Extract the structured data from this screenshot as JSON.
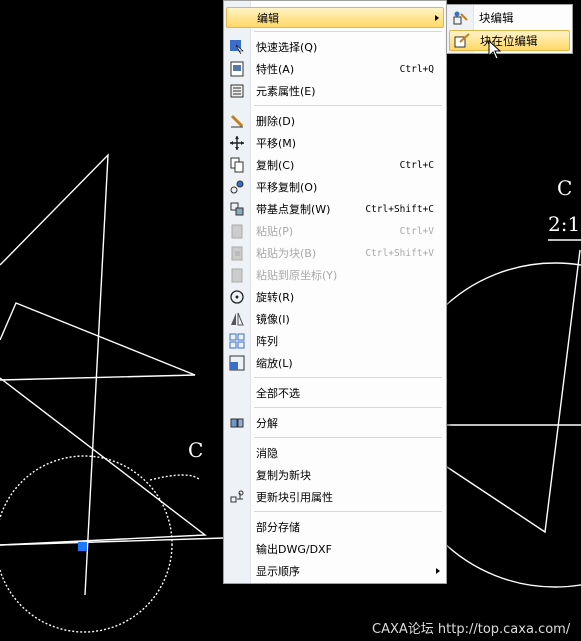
{
  "colors": {
    "background": "#000000",
    "highlight": "#ffd968",
    "selection_grip": "#1e78ff"
  },
  "menu": {
    "items": [
      {
        "id": "edit",
        "label": "编辑",
        "shortcut": "",
        "submenu": true,
        "highlight": true,
        "icon": ""
      },
      {
        "id": "quick-select",
        "label": "快速选择(Q)",
        "shortcut": "",
        "icon": "quick-select-icon"
      },
      {
        "id": "properties",
        "label": "特性(A)",
        "shortcut": "Ctrl+Q",
        "icon": "properties-icon"
      },
      {
        "id": "element-properties",
        "label": "元素属性(E)",
        "shortcut": "",
        "icon": "element-properties-icon"
      },
      {
        "id": "delete",
        "label": "删除(D)",
        "shortcut": "",
        "icon": "eraser-icon"
      },
      {
        "id": "move",
        "label": "平移(M)",
        "shortcut": "",
        "icon": "move-icon"
      },
      {
        "id": "copy",
        "label": "复制(C)",
        "shortcut": "Ctrl+C",
        "icon": "copy-icon"
      },
      {
        "id": "move-copy",
        "label": "平移复制(O)",
        "shortcut": "",
        "icon": "move-copy-icon"
      },
      {
        "id": "copy-base",
        "label": "带基点复制(W)",
        "shortcut": "Ctrl+Shift+C",
        "icon": "copy-base-icon"
      },
      {
        "id": "paste",
        "label": "粘贴(P)",
        "shortcut": "Ctrl+V",
        "disabled": true,
        "icon": "paste-icon"
      },
      {
        "id": "paste-block",
        "label": "粘贴为块(B)",
        "shortcut": "Ctrl+Shift+V",
        "disabled": true,
        "icon": "paste-block-icon"
      },
      {
        "id": "paste-origin",
        "label": "粘贴到原坐标(Y)",
        "shortcut": "",
        "disabled": true,
        "icon": "paste-origin-icon"
      },
      {
        "id": "rotate",
        "label": "旋转(R)",
        "shortcut": "",
        "icon": "rotate-icon"
      },
      {
        "id": "mirror",
        "label": "镜像(I)",
        "shortcut": "",
        "icon": "mirror-icon"
      },
      {
        "id": "array",
        "label": "阵列",
        "shortcut": "",
        "icon": "array-icon"
      },
      {
        "id": "scale",
        "label": "缩放(L)",
        "shortcut": "",
        "icon": "scale-icon"
      },
      {
        "id": "deselect-all",
        "label": "全部不选",
        "shortcut": "",
        "icon": ""
      },
      {
        "id": "explode",
        "label": "分解",
        "shortcut": "",
        "icon": "explode-icon"
      },
      {
        "id": "dissolve",
        "label": "消隐",
        "shortcut": "",
        "icon": ""
      },
      {
        "id": "copy-new-block",
        "label": "复制为新块",
        "shortcut": "",
        "icon": ""
      },
      {
        "id": "update-block-attr",
        "label": "更新块引用属性",
        "shortcut": "",
        "icon": "update-block-icon"
      },
      {
        "id": "partial-save",
        "label": "部分存储",
        "shortcut": "",
        "icon": ""
      },
      {
        "id": "export-dwg",
        "label": "输出DWG/DXF",
        "shortcut": "",
        "icon": ""
      },
      {
        "id": "display-order",
        "label": "显示顺序",
        "shortcut": "",
        "submenu": true,
        "icon": ""
      }
    ]
  },
  "submenu": {
    "items": [
      {
        "id": "block-edit",
        "label": "块编辑",
        "icon": "block-edit-icon"
      },
      {
        "id": "block-inplace-edit",
        "label": "块在位编辑",
        "icon": "block-inplace-edit-icon",
        "highlight": true
      }
    ]
  },
  "cad": {
    "label_c_right": "C",
    "label_scale": "2:1",
    "label_c_left": "C"
  },
  "watermark": "CAXA论坛 http://top.caxa.com/"
}
